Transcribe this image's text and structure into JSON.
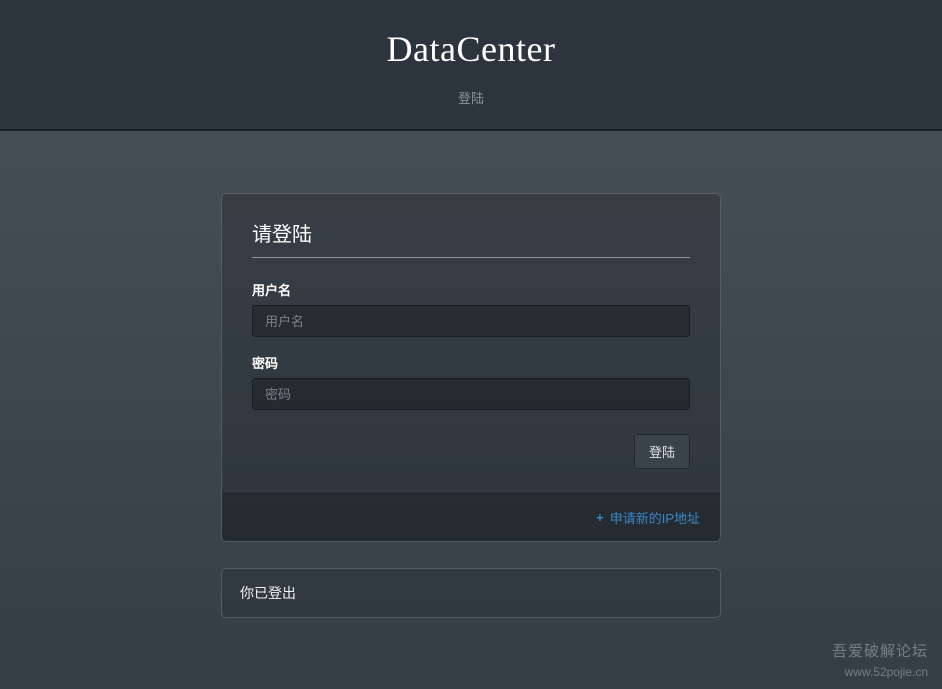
{
  "header": {
    "title": "DataCenter",
    "subtitle": "登陆"
  },
  "panel": {
    "title": "请登陆",
    "username_label": "用户名",
    "username_placeholder": "用户名",
    "password_label": "密码",
    "password_placeholder": "密码",
    "login_button": "登陆"
  },
  "footer_link": {
    "text": "申请新的IP地址"
  },
  "status": {
    "message": "你已登出"
  },
  "watermark": {
    "line1": "吾爱破解论坛",
    "line2": "www.52pojie.cn"
  }
}
